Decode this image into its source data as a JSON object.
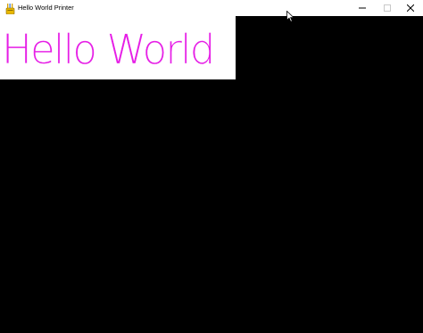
{
  "window": {
    "title": "Hello World Printer",
    "app_icon": "pencil-cup-icon",
    "controls": {
      "minimize_icon": "minimize-icon",
      "maximize_icon": "maximize-icon",
      "close_icon": "close-icon"
    }
  },
  "content": {
    "text": "Hello World",
    "text_color": "#e61ee6",
    "panel_color": "#ffffff",
    "canvas_color": "#000000"
  },
  "cursor_icon": "mouse-pointer-icon"
}
